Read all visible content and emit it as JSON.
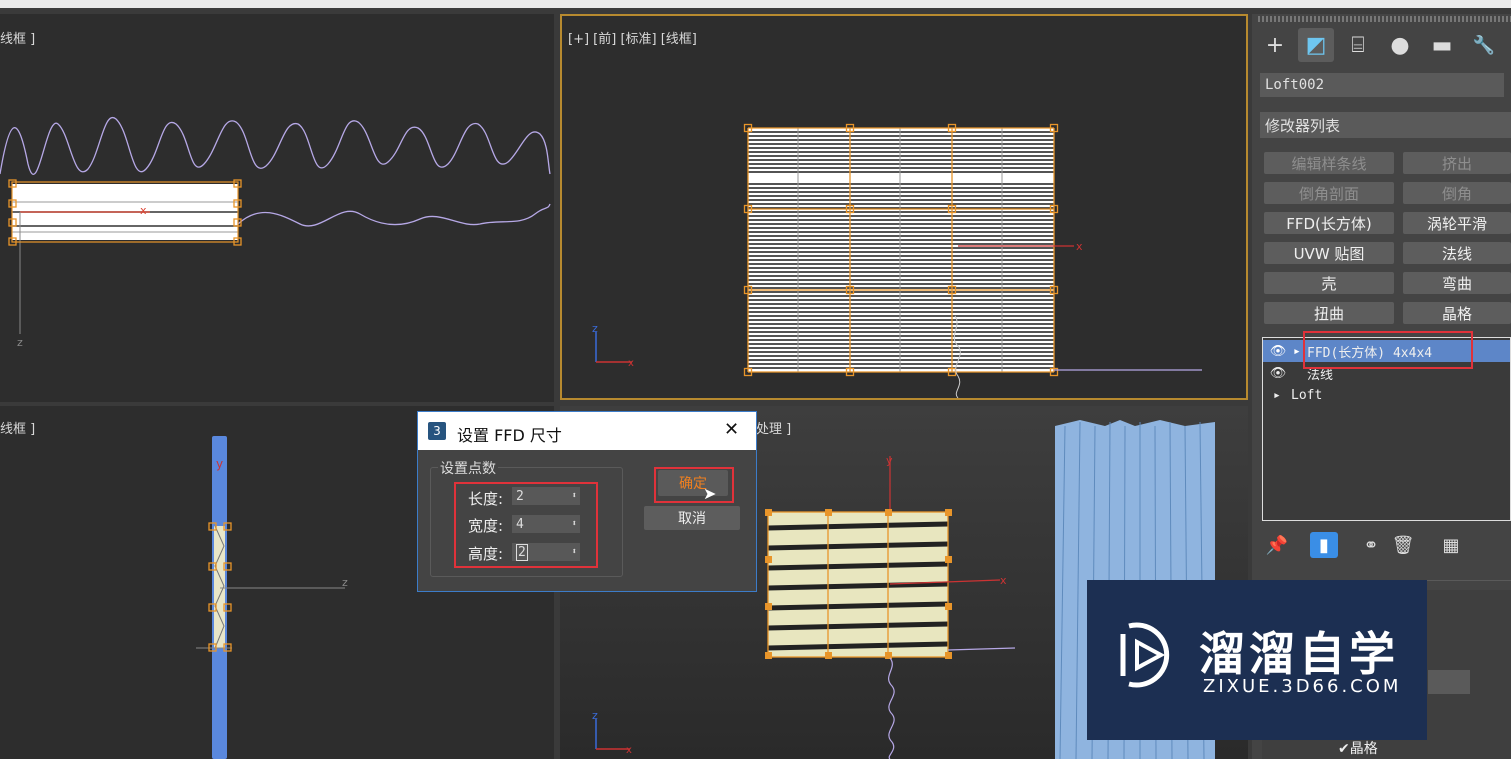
{
  "viewports": {
    "top_left": {
      "label": "线框 ]"
    },
    "top_right": {
      "label": "[+] [前] [标准] [线框]"
    },
    "bottom_left": {
      "label": "线框 ]"
    },
    "bottom_right": {
      "label": "处理 ]"
    }
  },
  "axes": {
    "x": "x",
    "y": "y",
    "z": "z"
  },
  "panel": {
    "tabs": [
      {
        "icon": "create-icon",
        "glyph": "+"
      },
      {
        "icon": "modify-icon",
        "glyph": "◩"
      },
      {
        "icon": "hierarchy-icon",
        "glyph": "⌸"
      },
      {
        "icon": "motion-icon",
        "glyph": "●"
      },
      {
        "icon": "display-icon",
        "glyph": "▬"
      },
      {
        "icon": "utilities-icon",
        "glyph": "🔧"
      }
    ],
    "object_name": "Loft002",
    "modifier_list": "修改器列表",
    "buttons": [
      {
        "label": "编辑样条线",
        "enabled": false
      },
      {
        "label": "挤出",
        "enabled": false
      },
      {
        "label": "倒角剖面",
        "enabled": false
      },
      {
        "label": "倒角",
        "enabled": false
      },
      {
        "label": "FFD(长方体)",
        "enabled": true
      },
      {
        "label": "涡轮平滑",
        "enabled": true
      },
      {
        "label": "UVW 贴图",
        "enabled": true
      },
      {
        "label": "法线",
        "enabled": true
      },
      {
        "label": "壳",
        "enabled": true
      },
      {
        "label": "弯曲",
        "enabled": true
      },
      {
        "label": "扭曲",
        "enabled": true
      },
      {
        "label": "晶格",
        "enabled": true
      }
    ],
    "stack": [
      {
        "label": "FFD(长方体) 4x4x4",
        "selected": true
      },
      {
        "label": "法线",
        "selected": false
      },
      {
        "label": "Loft",
        "selected": false
      }
    ],
    "bottom_checkbox": "晶格"
  },
  "dialog": {
    "title": "设置 FFD 尺寸",
    "badge": "3",
    "close": "✕",
    "group_label": "设置点数",
    "fields": [
      {
        "label": "长度:",
        "value": "2"
      },
      {
        "label": "宽度:",
        "value": "4"
      },
      {
        "label": "高度:",
        "value": "2"
      }
    ],
    "ok": "确定",
    "cancel": "取消"
  },
  "watermark": {
    "name": "溜溜自学",
    "url": "ZIXUE.3D66.COM"
  },
  "colors": {
    "accent_orange": "#e8952a",
    "highlight_red": "#e0323a",
    "selection_blue": "#5d86c8"
  }
}
